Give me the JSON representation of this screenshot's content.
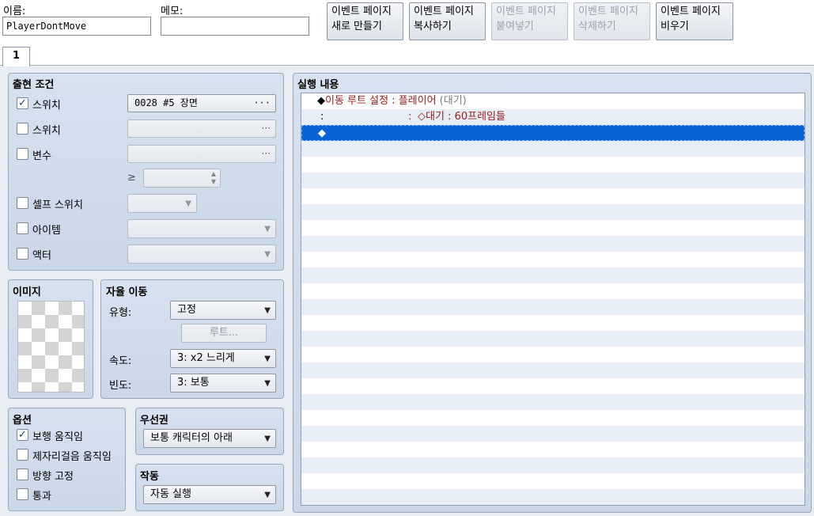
{
  "header": {
    "name_label": "이름:",
    "name_value": "PlayerDontMove",
    "memo_label": "메모:",
    "memo_value": "",
    "buttons": [
      {
        "line1": "이벤트 페이지",
        "line2": "새로 만들기",
        "enabled": true
      },
      {
        "line1": "이벤트 페이지",
        "line2": "복사하기",
        "enabled": true
      },
      {
        "line1": "이벤트 페이지",
        "line2": "붙여넣기",
        "enabled": false
      },
      {
        "line1": "이벤트 페이지",
        "line2": "삭제하기",
        "enabled": false
      },
      {
        "line1": "이벤트 페이지",
        "line2": "비우기",
        "enabled": true
      }
    ]
  },
  "tabs": [
    {
      "label": "1",
      "active": true
    }
  ],
  "conditions": {
    "title": "출현 조건",
    "switch1": {
      "label": "스위치",
      "checked": true,
      "value": "0028 #5 장면"
    },
    "switch2": {
      "label": "스위치",
      "checked": false,
      "value": ""
    },
    "variable": {
      "label": "변수",
      "checked": false,
      "value": ""
    },
    "compare_symbol": "≥",
    "self_switch": {
      "label": "셀프 스위치",
      "checked": false
    },
    "item": {
      "label": "아이템",
      "checked": false
    },
    "actor": {
      "label": "액터",
      "checked": false
    },
    "browse_icon": "ellipsis-icon"
  },
  "image": {
    "title": "이미지"
  },
  "autonomous": {
    "title": "자율 이동",
    "type_label": "유형:",
    "type_value": "고정",
    "route_button": "루트...",
    "speed_label": "속도:",
    "speed_value": "3: x2 느리게",
    "freq_label": "빈도:",
    "freq_value": "3: 보통"
  },
  "options": {
    "title": "옵션",
    "items": [
      {
        "label": "보행 움직임",
        "checked": true
      },
      {
        "label": "제자리걸음 움직임",
        "checked": false
      },
      {
        "label": "방향 고정",
        "checked": false
      },
      {
        "label": "통과",
        "checked": false
      }
    ]
  },
  "priority": {
    "title": "우선권",
    "value": "보통 캐릭터의 아래"
  },
  "trigger": {
    "title": "작동",
    "value": "자동 실행"
  },
  "contents": {
    "title": "실행 내용",
    "line1": {
      "bullet": "◆",
      "command": "이동 루트 설정",
      "sep": " : ",
      "target": "플레이어",
      "extra": " (대기)"
    },
    "line2": {
      "prefix": ":",
      "sep": ": ",
      "command": "◇대기 : 60프레임들"
    },
    "line3": {
      "bullet": "◆"
    }
  },
  "colors": {
    "selection": "#0a64d8",
    "command_text": "#9b1b1b",
    "panel_bg": "#d2deec"
  }
}
